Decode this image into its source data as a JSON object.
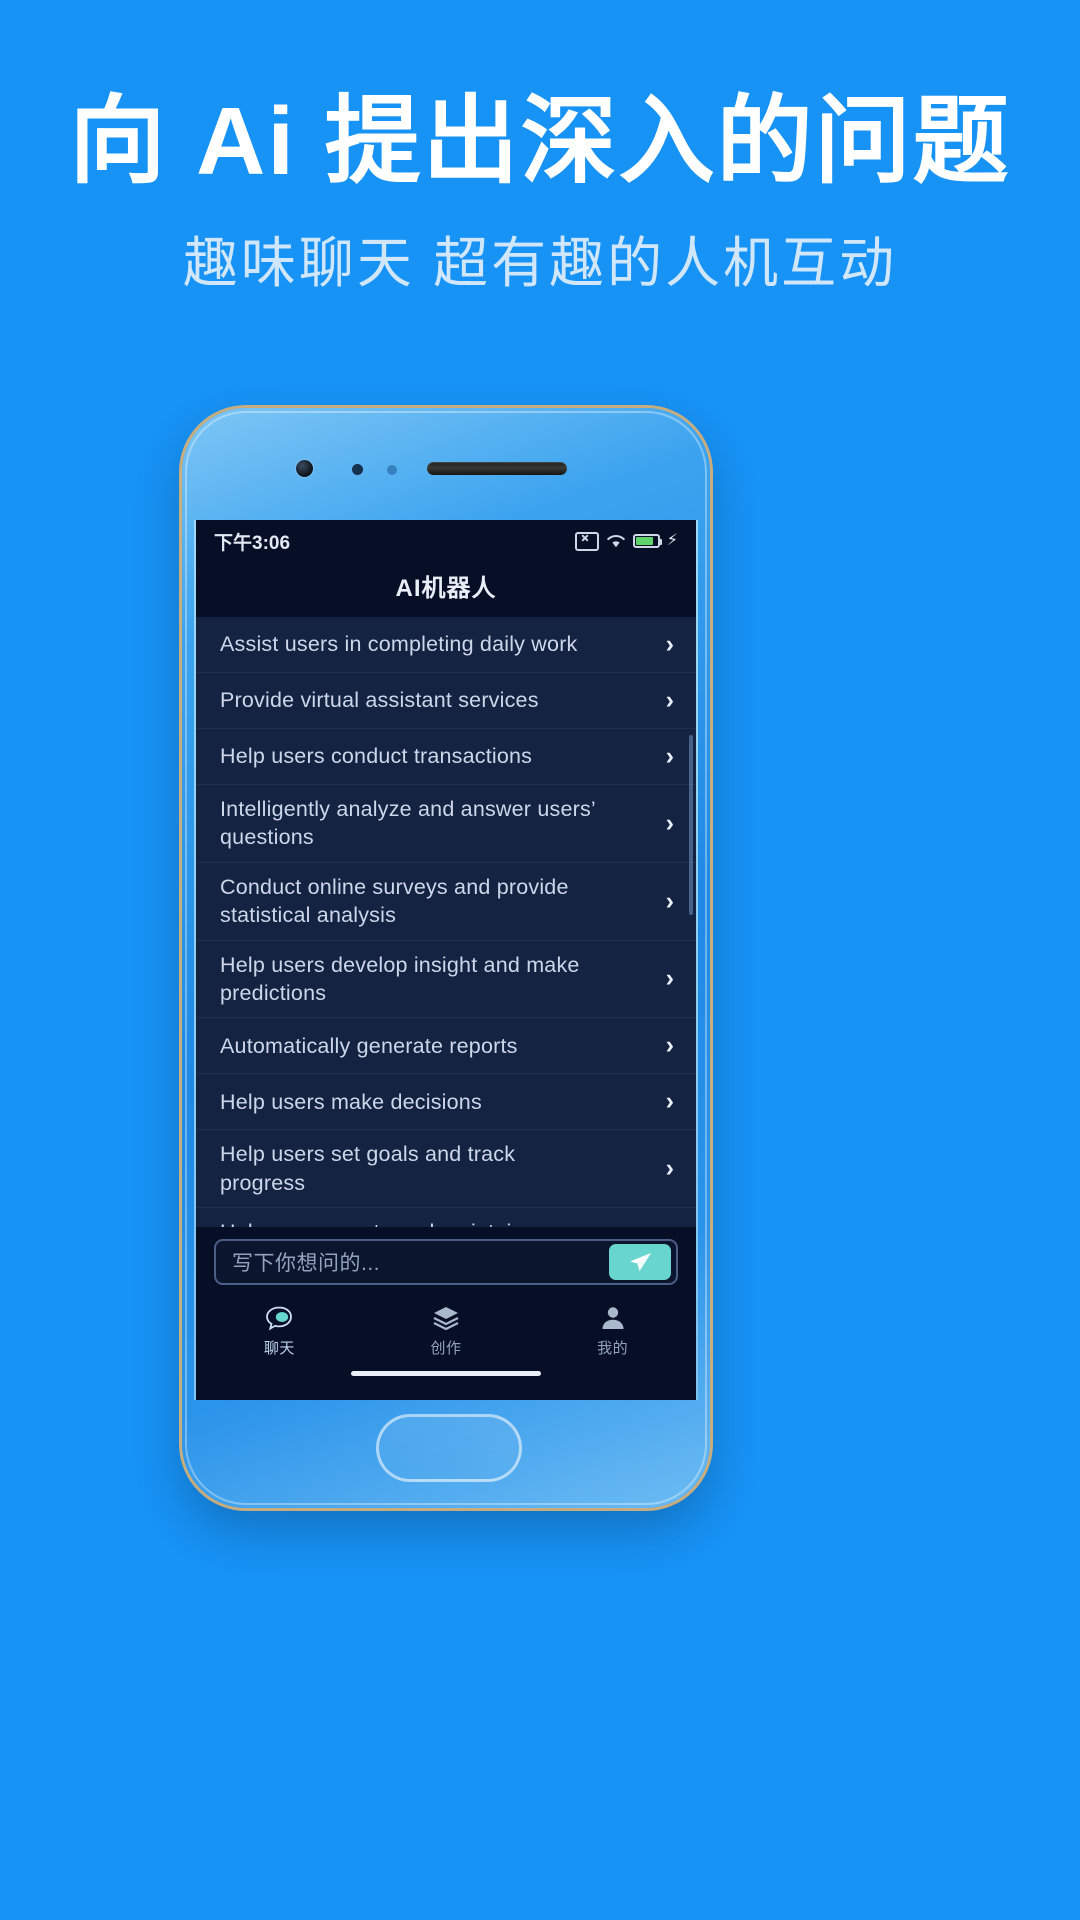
{
  "promo": {
    "title": "向 Ai 提出深入的问题",
    "subtitle": "趣味聊天 超有趣的人机互动",
    "background_color": "#1792f5",
    "title_color": "#ffffff",
    "subtitle_color": "#cfe6fb"
  },
  "phone": {
    "status_bar": {
      "time": "下午3:06",
      "icons": [
        "sim-off-icon",
        "wifi-icon",
        "battery-icon",
        "charging-bolt-icon"
      ],
      "battery_level_percent": 82
    },
    "app": {
      "title": "AI机器人",
      "accent_color": "#68d6ce",
      "screen_background": "#060f26",
      "list_background": "#152342",
      "suggestions": [
        {
          "label": "Assist users in completing daily work",
          "chevron": "›"
        },
        {
          "label": "Provide virtual assistant services",
          "chevron": "›"
        },
        {
          "label": "Help users conduct transactions",
          "chevron": "›"
        },
        {
          "label": "Intelligently analyze and answer users’ questions",
          "chevron": "›"
        },
        {
          "label": "Conduct online surveys and provide statistical analysis",
          "chevron": "›"
        },
        {
          "label": "Help users develop insight and make predictions",
          "chevron": "›"
        },
        {
          "label": "Automatically generate reports",
          "chevron": "›"
        },
        {
          "label": "Help users make decisions",
          "chevron": "›"
        },
        {
          "label": "Help users set goals and track progress",
          "chevron": "›"
        },
        {
          "label": "Help users create and maintain databases",
          "chevron": "›"
        }
      ],
      "composer": {
        "placeholder": "写下你想问的...",
        "send_icon": "paper-plane-icon"
      },
      "tabs": [
        {
          "label": "聊天",
          "icon": "chat-bubble-icon",
          "active": true
        },
        {
          "label": "创作",
          "icon": "layers-box-icon",
          "active": false
        },
        {
          "label": "我的",
          "icon": "person-icon",
          "active": false
        }
      ]
    }
  }
}
